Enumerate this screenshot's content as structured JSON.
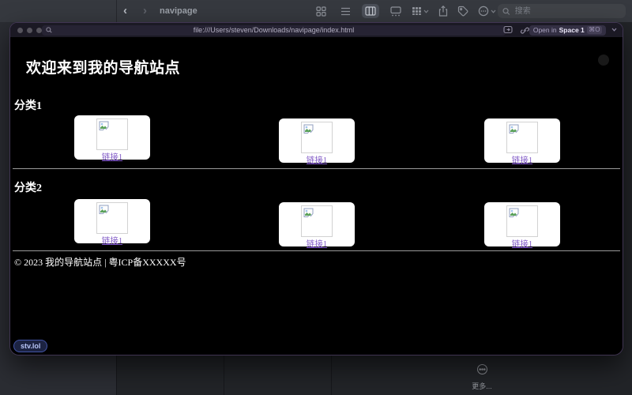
{
  "finder": {
    "toolbar": {
      "back_glyph": "‹",
      "forward_glyph": "›",
      "title": "navipage",
      "search_placeholder": "搜索"
    },
    "preview": {
      "more_label": "更多..."
    }
  },
  "browser": {
    "url": "file:///Users/steven/Downloads/navipage/index.html",
    "open_button": {
      "prefix": "Open in",
      "space": "Space 1",
      "shortcut": "⌘O"
    }
  },
  "page": {
    "title": "欢迎来到我的导航站点",
    "sections": [
      {
        "heading": "分类1",
        "cards": [
          {
            "label": "链接1"
          },
          {
            "label": "链接1"
          },
          {
            "label": "链接1"
          }
        ]
      },
      {
        "heading": "分类2",
        "cards": [
          {
            "label": "链接1"
          },
          {
            "label": "链接1"
          },
          {
            "label": "链接1"
          }
        ]
      }
    ],
    "footer": "© 2023 我的导航站点 | 粤ICP备XXXXX号",
    "badge": "stv.lol"
  },
  "icons": {
    "view_modes": [
      "icon-grid",
      "list",
      "columns-selected",
      "gallery"
    ],
    "toolbar_actions": [
      "group-by",
      "share",
      "tag",
      "more-circle"
    ],
    "url_bar": [
      "magnifier",
      "picture-in-picture",
      "copy-link"
    ],
    "broken_image": "torn-picture"
  },
  "colors": {
    "link_purple": "#7d55c5",
    "page_bg": "#000000",
    "card_bg": "#ffffff",
    "window_border": "#403552",
    "toolbar_bg": "#36393f",
    "badge_border": "#4254a6"
  }
}
